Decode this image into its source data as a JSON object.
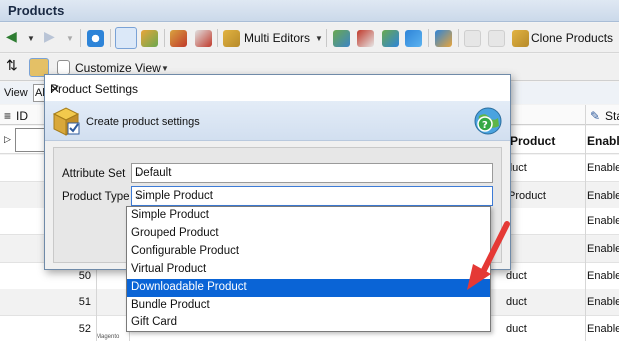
{
  "app": {
    "title": "Products"
  },
  "toolbar": {
    "multi_editors_label": "Multi Editors",
    "clone_products_label": "Clone Products",
    "customize_view_label": "Customize View"
  },
  "view_row": {
    "label": "View",
    "value": "All"
  },
  "grid": {
    "id_header": "ID",
    "status_header": "Sta",
    "product_type_header": "Product",
    "status_sub_header": "Enable",
    "rows": [
      {
        "id": "",
        "product": "duct",
        "status": "Enable"
      },
      {
        "id": "",
        "product": "Product",
        "status": "Enable"
      },
      {
        "id": "",
        "product": "",
        "status": "Enable"
      },
      {
        "id": "",
        "product": "",
        "status": "Enable"
      },
      {
        "id": "50",
        "product": "duct",
        "status": "Enable"
      },
      {
        "id": "51",
        "product": "duct",
        "status": "Enable"
      },
      {
        "id": "52",
        "product": "duct",
        "status": "Enable"
      }
    ],
    "thumb_text": "Magento"
  },
  "dialog": {
    "title": "Product Settings",
    "header_text": "Create product settings",
    "attribute_set_label": "Attribute Set",
    "attribute_set_value": "Default",
    "product_type_label": "Product Type",
    "product_type_value": "Simple Product",
    "options": [
      "Simple Product",
      "Grouped Product",
      "Configurable Product",
      "Virtual Product",
      "Downloadable Product",
      "Bundle Product",
      "Gift Card"
    ],
    "highlighted_option": "Downloadable Product"
  },
  "colors": {
    "selection": "#0a64d6",
    "annotation_arrow": "#e53935",
    "header_band": "#d2dff0"
  }
}
